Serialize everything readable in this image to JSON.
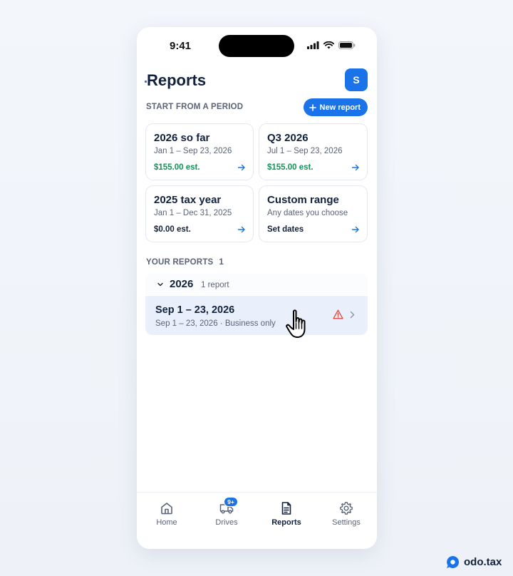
{
  "status_bar": {
    "time": "9:41"
  },
  "header": {
    "title": "Reports",
    "avatar_initial": "S"
  },
  "periods": {
    "label": "START FROM A PERIOD",
    "new_report_label": "New report",
    "cards": [
      {
        "title": "2026 so far",
        "dates": "Jan 1 – Sep 23, 2026",
        "estimate": "$155.00 est."
      },
      {
        "title": "Q3 2026",
        "dates": "Jul 1 – Sep 23, 2026",
        "estimate": "$155.00 est."
      },
      {
        "title": "2025 tax year",
        "dates": "Jan 1 – Dec 31, 2025",
        "estimate": "$0.00 est."
      },
      {
        "title": "Custom range",
        "dates": "Any dates you choose",
        "estimate": "Set dates"
      }
    ]
  },
  "your_reports": {
    "label": "YOUR REPORTS",
    "count": "1",
    "group": {
      "year": "2026",
      "sub": "1 report"
    },
    "items": [
      {
        "title": "Sep 1 – 23, 2026",
        "subtitle": "Sep 1 – 23, 2026 · Business only"
      }
    ]
  },
  "tabbar": {
    "tabs": [
      {
        "label": "Home"
      },
      {
        "label": "Drives",
        "badge": "9+"
      },
      {
        "label": "Reports"
      },
      {
        "label": "Settings"
      }
    ]
  },
  "brand": {
    "name": "odo.tax"
  },
  "colors": {
    "accent": "#1a73e8",
    "positive": "#16915a",
    "warning": "#e0453a"
  }
}
